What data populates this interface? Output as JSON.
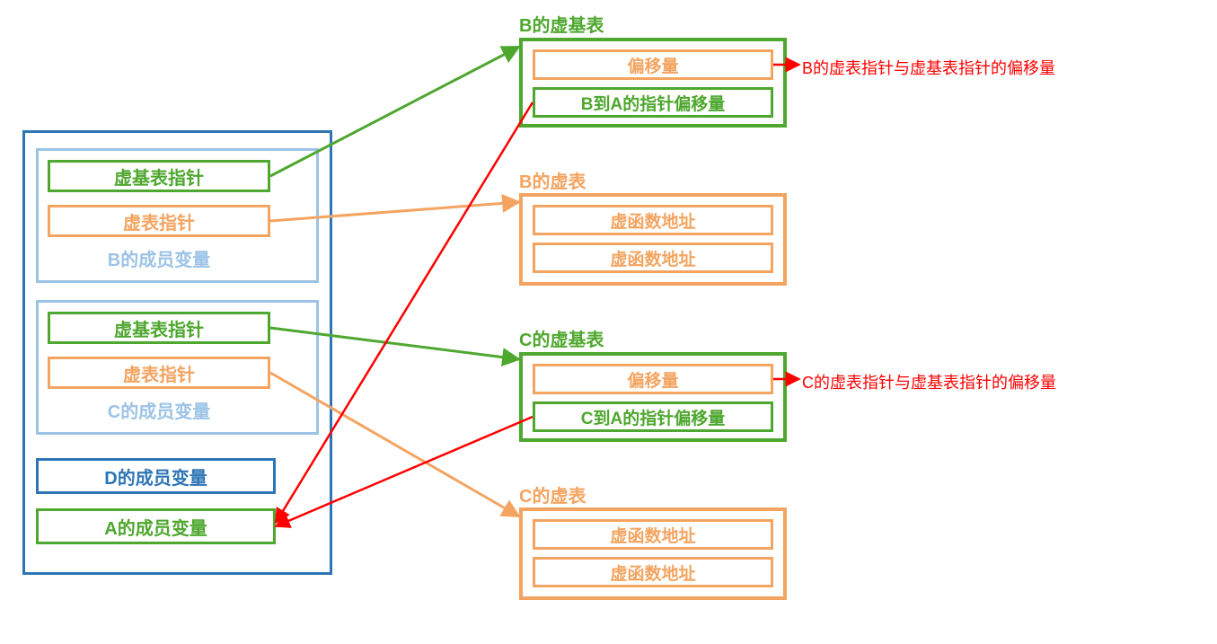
{
  "left": {
    "b_vbptr": "虚基表指针",
    "b_vptr": "虚表指针",
    "b_members": "B的成员变量",
    "c_vbptr": "虚基表指针",
    "c_vptr": "虚表指针",
    "c_members": "C的成员变量",
    "d_members": "D的成员变量",
    "a_members": "A的成员变量"
  },
  "right": {
    "b_vbtable_title": "B的虚基表",
    "b_vbtable_offset": "偏移量",
    "b_vbtable_aoffset": "B到A的指针偏移量",
    "b_vtable_title": "B的虚表",
    "b_vtable_fn1": "虚函数地址",
    "b_vtable_fn2": "虚函数地址",
    "c_vbtable_title": "C的虚基表",
    "c_vbtable_offset": "偏移量",
    "c_vbtable_aoffset": "C到A的指针偏移量",
    "c_vtable_title": "C的虚表",
    "c_vtable_fn1": "虚函数地址",
    "c_vtable_fn2": "虚函数地址"
  },
  "annotations": {
    "b_note": "B的虚表指针与虚基表指针的偏移量",
    "c_note": "C的虚表指针与虚基表指针的偏移量"
  },
  "colors": {
    "blue": "#2E75B6",
    "lightblue": "#9CC3E6",
    "green": "#4EA72E",
    "orange": "#F4A460",
    "red": "#FF0000"
  }
}
